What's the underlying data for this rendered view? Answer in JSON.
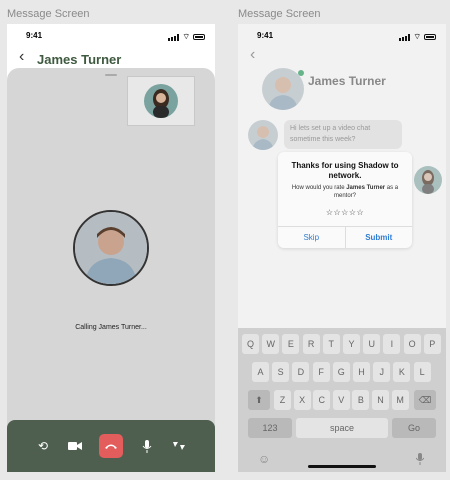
{
  "frames": {
    "left_label": "Message Screen",
    "right_label": "Message Screen"
  },
  "status_bar": {
    "time": "9:41"
  },
  "call_screen": {
    "title": "James Turner",
    "calling_text": "Calling James Turner...",
    "controls": [
      "switch-camera-icon",
      "video-icon",
      "end-call-icon",
      "microphone-icon",
      "speaker-icon"
    ],
    "end_call_color": "#e35d5d",
    "controls_bg": "#4f5f4f"
  },
  "message_screen": {
    "contact_name": "James Turner",
    "message": "Hi lets set up a video chat sometime this week?",
    "rating_dialog": {
      "title": "Thanks for using Shadow to network.",
      "message_pre": "How would you rate ",
      "message_name": "James Turner",
      "message_post": " as a mentor?",
      "stars": "☆☆☆☆☆",
      "skip_label": "Skip",
      "submit_label": "Submit"
    },
    "keyboard": {
      "row1": [
        "Q",
        "W",
        "E",
        "R",
        "T",
        "Y",
        "U",
        "I",
        "O",
        "P"
      ],
      "row2": [
        "A",
        "S",
        "D",
        "F",
        "G",
        "H",
        "J",
        "K",
        "L"
      ],
      "row3": [
        "Z",
        "X",
        "C",
        "V",
        "B",
        "N",
        "M"
      ],
      "numbers_label": "123",
      "space_label": "space",
      "go_label": "Go"
    }
  },
  "colors": {
    "title_green": "#3f5a40",
    "link_blue": "#2f7cd4",
    "online_green": "#67b48a"
  }
}
